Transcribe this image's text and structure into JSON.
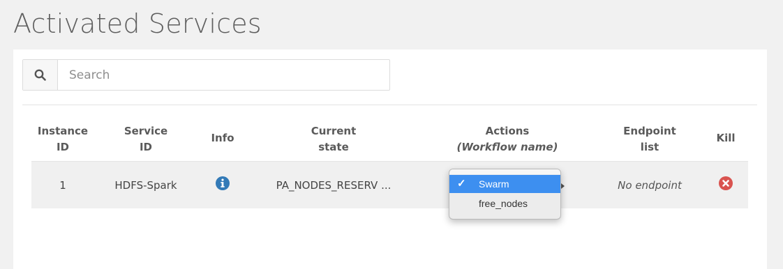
{
  "page": {
    "title": "Activated Services"
  },
  "search": {
    "placeholder": "Search",
    "value": ""
  },
  "table": {
    "headers": [
      {
        "line1": "Instance",
        "line2": "ID"
      },
      {
        "line1": "Service",
        "line2": "ID"
      },
      {
        "line1": "Info",
        "line2": ""
      },
      {
        "line1": "Current",
        "line2": "state"
      },
      {
        "line1": "Actions",
        "line2": "(Workflow name)"
      },
      {
        "line1": "Endpoint",
        "line2": "list"
      },
      {
        "line1": "Kill",
        "line2": ""
      }
    ],
    "rows": [
      {
        "instance_id": "1",
        "service_id": "HDFS-Spark",
        "current_state": "PA_NODES_RESERV ...",
        "endpoint": "No endpoint"
      }
    ]
  },
  "actions_menu": {
    "options": [
      "Swarm",
      "free_nodes"
    ],
    "selected": "Swarm",
    "check_mark": "✓"
  },
  "colors": {
    "info_icon": "#337ab7",
    "kill_icon": "#d9534f",
    "menu_highlight": "#3d8ff0"
  },
  "icons": [
    "search-icon",
    "info-icon",
    "kill-icon",
    "checkmark-icon",
    "submenu-arrow-icon"
  ]
}
